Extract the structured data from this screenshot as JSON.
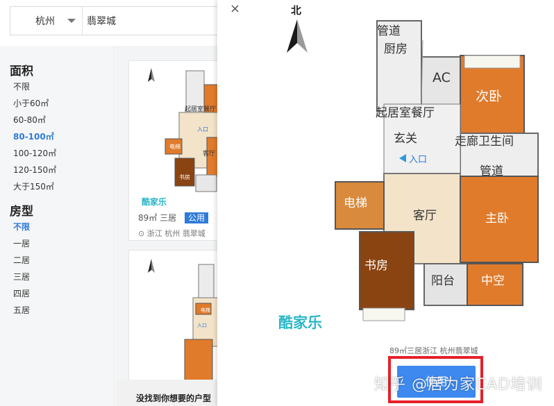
{
  "search": {
    "city": "杭州",
    "query": "翡翠城"
  },
  "filters": {
    "area": {
      "title": "面积",
      "options": [
        "不限",
        "小于60㎡",
        "60-80㎡",
        "80-100㎡",
        "100-120㎡",
        "120-150㎡",
        "大于150㎡"
      ],
      "selected": "80-100㎡"
    },
    "type": {
      "title": "房型",
      "options": [
        "不限",
        "一居",
        "二居",
        "三居",
        "四居",
        "五居"
      ],
      "selected": "不限"
    }
  },
  "cards": [
    {
      "brand": "酷家乐",
      "area": "89㎡",
      "rooms": "三居",
      "tag": "公用",
      "location": "浙江 杭州",
      "community": "翡翠城"
    }
  ],
  "not_found_text": "没找到你想要的户型",
  "modal": {
    "close_label": "×",
    "compass_label": "北",
    "brand": "酷家乐",
    "rooms": {
      "corridor_top": "管道",
      "kitchen": "厨房",
      "ac": "AC",
      "second_bedroom": "次卧",
      "living_dining": "起居室餐厅",
      "foyer": "玄关",
      "corridor": "走廊",
      "bathroom": "卫生间",
      "pipe": "管道",
      "entrance": "入口",
      "elevator": "电梯",
      "living_room": "客厅",
      "master_bedroom": "主卧",
      "study": "书房",
      "balcony": "阳台",
      "void": "中空"
    },
    "caption": "89㎡三居浙江 杭州翡翠城",
    "cta_label": "使用",
    "watermark": "知乎 @居为家CAD培训"
  },
  "colors": {
    "accent": "#2f7bd9",
    "button": "#3d89f0",
    "highlight_frame": "#e6202a",
    "room_orange": "#e07b2c",
    "room_brown": "#8a4412",
    "floor_beige": "#f3e3c9"
  }
}
